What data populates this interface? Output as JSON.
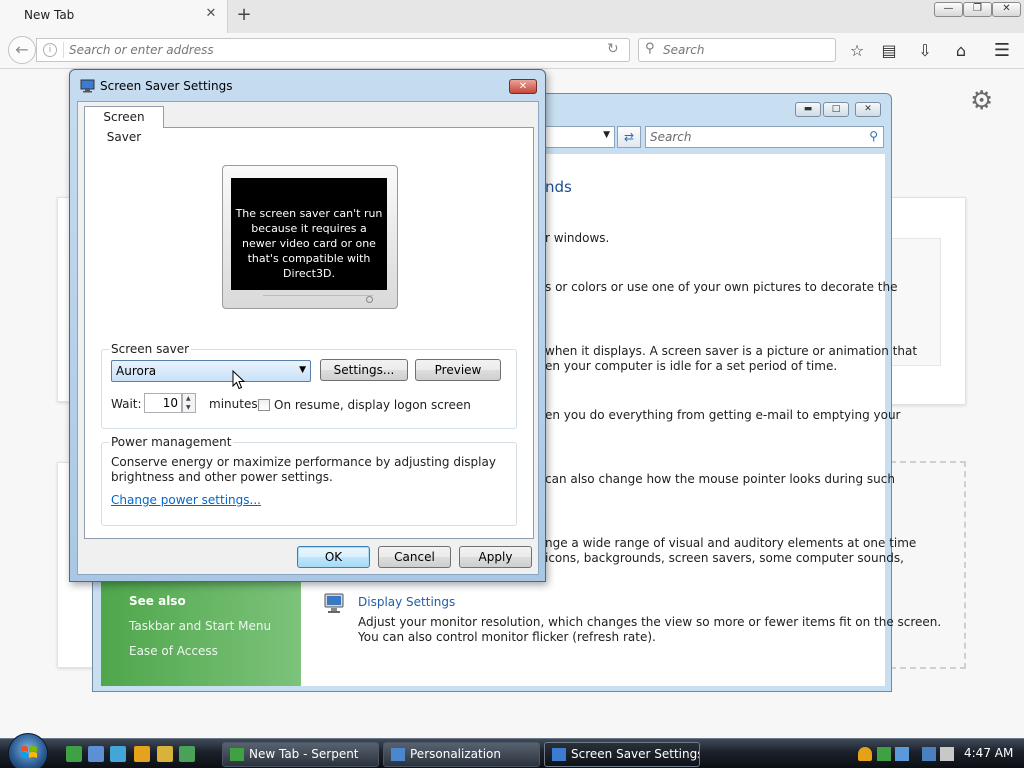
{
  "browser": {
    "tab_label": "New Tab",
    "tab_close": "✕",
    "new_tab": "+",
    "url_placeholder": "Search or enter address",
    "search_placeholder": "Search",
    "window_controls": {
      "minimize": "—",
      "restore": "❐",
      "close": "✕"
    }
  },
  "personalization": {
    "heading": "nds",
    "search_placeholder": "Search",
    "fragments": [
      "r windows.",
      "s or colors or use one of your own pictures to decorate the",
      "when it displays. A screen saver is a picture or animation that",
      "en your computer is idle for a set period of time.",
      "en you do everything from getting e-mail to emptying your",
      "can also change how the mouse pointer looks during such",
      "nge a wide range of visual and auditory elements at one time",
      " icons, backgrounds, screen savers, some computer sounds,"
    ],
    "see_also": {
      "title": "See also",
      "items": [
        "Taskbar and Start Menu",
        "Ease of Access"
      ]
    },
    "display_settings": {
      "link": "Display Settings",
      "desc_line1": "Adjust your monitor resolution, which changes the view so more or fewer items fit on the screen.",
      "desc_line2": "You can also control monitor flicker (refresh rate)."
    }
  },
  "dialog": {
    "title": "Screen Saver Settings",
    "close": "✕",
    "tab": "Screen Saver",
    "preview_message": "The screen saver can't run because it requires a newer video card or one that's compatible with Direct3D.",
    "screensaver_group": "Screen saver",
    "selected_screensaver": "Aurora",
    "settings_button": "Settings...",
    "preview_button": "Preview",
    "wait_label": "Wait:",
    "wait_value": "10",
    "minutes_label": "minutes",
    "resume_label": "On resume, display logon screen",
    "resume_checked": false,
    "power_group": "Power management",
    "power_line1": "Conserve energy or maximize performance by adjusting display",
    "power_line2": "brightness and other power settings.",
    "power_link": "Change power settings...",
    "ok": "OK",
    "cancel": "Cancel",
    "apply": "Apply"
  },
  "taskbar": {
    "buttons": [
      "New Tab - Serpent",
      "Personalization",
      "Screen Saver Settings"
    ],
    "clock": "4:47 AM"
  },
  "colors": {
    "link_blue": "#0066cc",
    "heading_blue": "#1d4f8f",
    "sidebar_green": "#4fa64b",
    "dialog_close_red": "#c7453a"
  }
}
